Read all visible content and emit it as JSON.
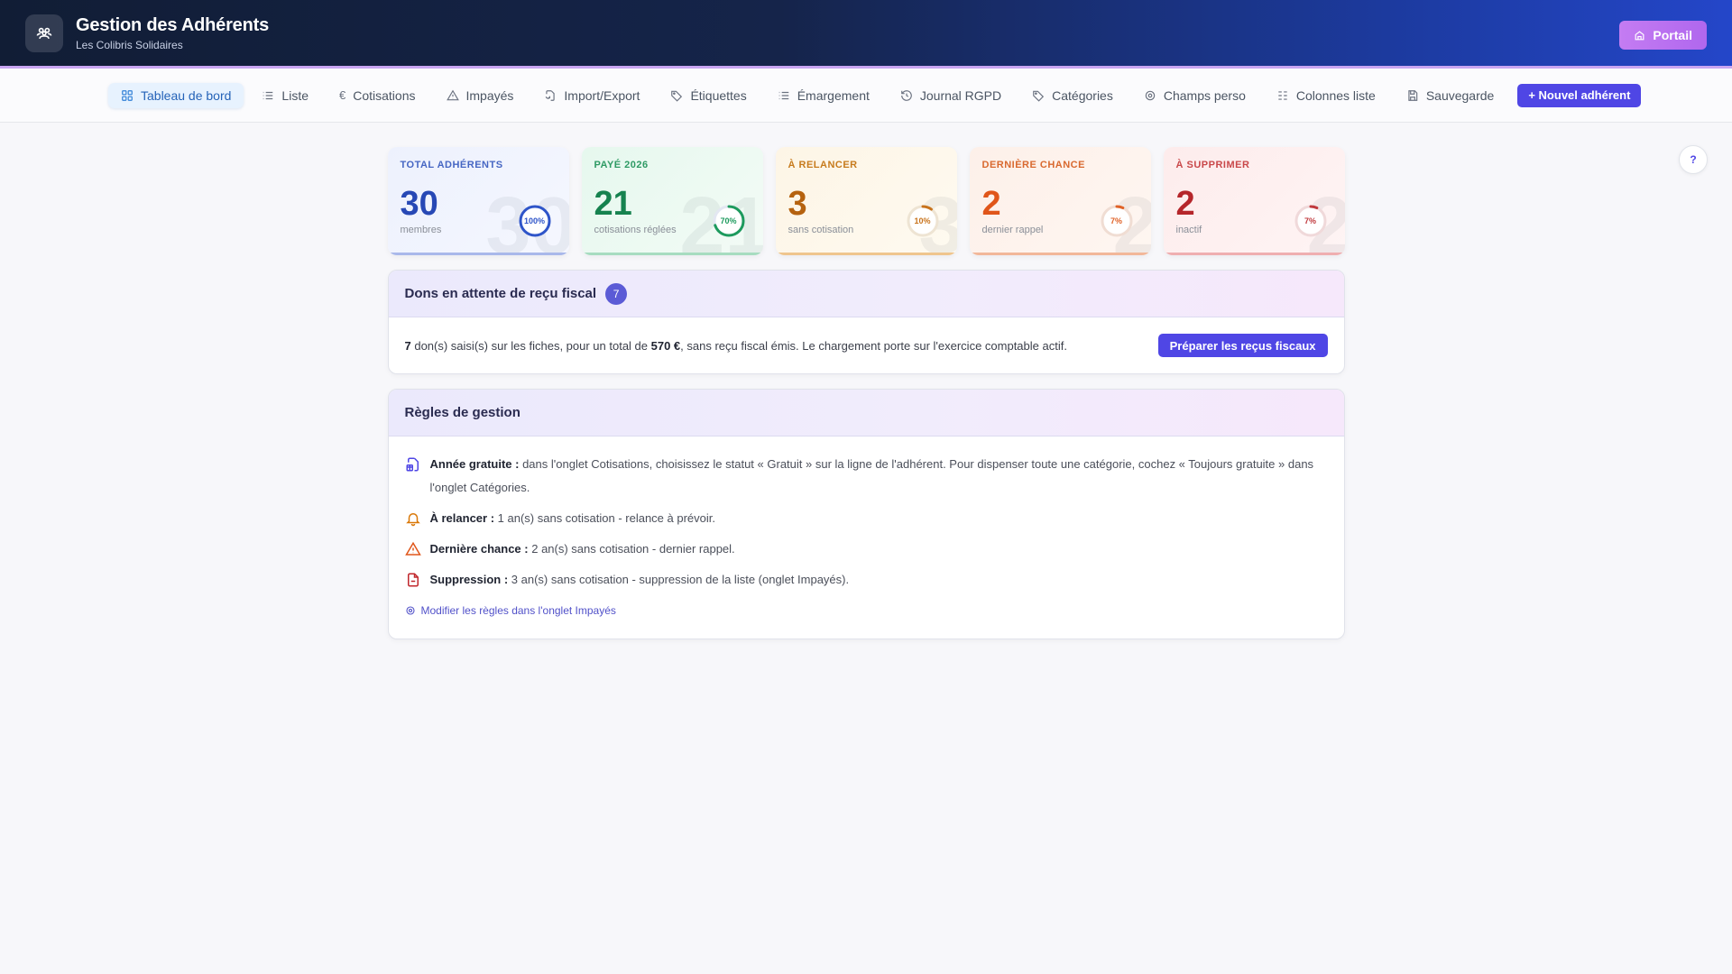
{
  "header": {
    "title": "Gestion des Adhérents",
    "subtitle": "Les Colibris Solidaires",
    "portal_label": "Portail"
  },
  "tabs": [
    {
      "label": "Tableau de bord",
      "icon": "grid-icon",
      "active": true
    },
    {
      "label": "Liste",
      "icon": "list-icon"
    },
    {
      "label": "Cotisations",
      "icon": "euro-icon"
    },
    {
      "label": "Impayés",
      "icon": "warning-icon"
    },
    {
      "label": "Import/Export",
      "icon": "file-sync-icon"
    },
    {
      "label": "Étiquettes",
      "icon": "tag-icon"
    },
    {
      "label": "Émargement",
      "icon": "list-icon"
    },
    {
      "label": "Journal RGPD",
      "icon": "history-icon"
    },
    {
      "label": "Catégories",
      "icon": "tag-icon"
    },
    {
      "label": "Champs perso",
      "icon": "gear-icon"
    },
    {
      "label": "Colonnes liste",
      "icon": "columns-icon"
    },
    {
      "label": "Sauvegarde",
      "icon": "save-icon"
    }
  ],
  "new_member_label": "+ Nouvel adhérent",
  "help_label": "?",
  "stats": [
    {
      "label": "Total adhérents",
      "value": "30",
      "caption": "membres",
      "percent": "100%",
      "fraction": 1.0,
      "color": "#2f55c9"
    },
    {
      "label": "Payé 2026",
      "value": "21",
      "caption": "cotisations réglées",
      "percent": "70%",
      "fraction": 0.7,
      "color": "#1d9a5d"
    },
    {
      "label": "À relancer",
      "value": "3",
      "caption": "sans cotisation",
      "percent": "10%",
      "fraction": 0.1,
      "color": "#c8731b"
    },
    {
      "label": "Dernière chance",
      "value": "2",
      "caption": "dernier rappel",
      "percent": "7%",
      "fraction": 0.07,
      "color": "#e06227"
    },
    {
      "label": "À supprimer",
      "value": "2",
      "caption": "inactif",
      "percent": "7%",
      "fraction": 0.07,
      "color": "#c0393d"
    }
  ],
  "donations": {
    "title": "Dons en attente de reçu fiscal",
    "count": "7",
    "count_strong": "7",
    "text_1": " don(s) saisi(s) sur les fiches, pour un total de ",
    "amount": "570 €",
    "text_2": ", sans reçu fiscal émis. Le chargement porte sur l'exercice comptable actif.",
    "button_label": "Préparer les reçus fiscaux"
  },
  "rules": {
    "title": "Règles de gestion",
    "items": [
      {
        "name": "Année gratuite :",
        "text": " dans l'onglet Cotisations, choisissez le statut « Gratuit » sur la ligne de l'adhérent. Pour dispenser toute une catégorie, cochez « Toujours gratuite » dans l'onglet Catégories.",
        "icon": "gift-document-icon",
        "color": "#4f46e5"
      },
      {
        "name": "À relancer :",
        "text": " 1 an(s) sans cotisation - relance à prévoir.",
        "icon": "bell-icon",
        "color": "#d97706"
      },
      {
        "name": "Dernière chance :",
        "text": " 2 an(s) sans cotisation - dernier rappel.",
        "icon": "warning-icon",
        "color": "#e0561a"
      },
      {
        "name": "Suppression :",
        "text": " 3 an(s) sans cotisation - suppression de la liste (onglet Impayés).",
        "icon": "file-minus-icon",
        "color": "#c0262b"
      }
    ],
    "edit_link": "Modifier les règles dans l'onglet Impayés"
  }
}
